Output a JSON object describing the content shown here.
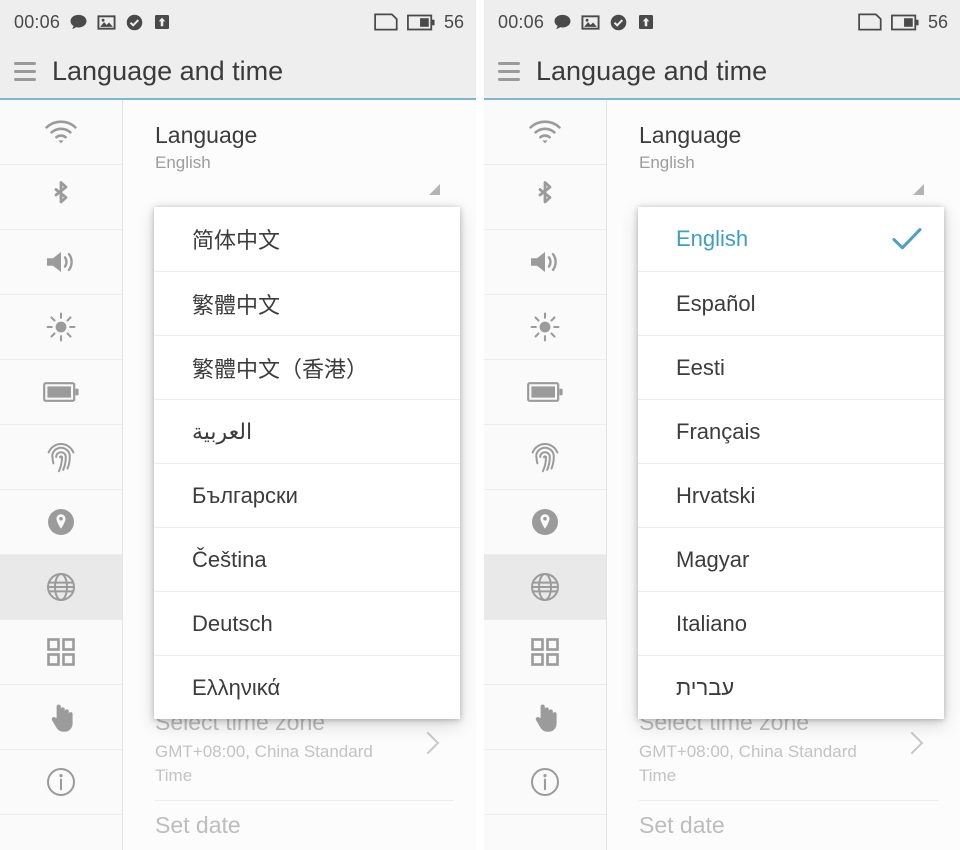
{
  "meta": {
    "accent_color": "#3f9dc4",
    "check_color": "#4aa0c6",
    "header_bg": "#eeeeee",
    "rail_icon_color": "#9b9b9b"
  },
  "status_bar": {
    "time": "00:06",
    "battery_percent": "56",
    "left_icons": [
      "message-icon",
      "photo-icon",
      "check-circle-icon",
      "upload-icon"
    ],
    "right_icons": [
      "sim-card-icon",
      "battery-icon"
    ]
  },
  "header": {
    "menu_icon": "hamburger-icon",
    "title": "Language and time"
  },
  "sidebar": {
    "items": [
      {
        "icon": "wifi-icon",
        "name": "wifi",
        "active": false
      },
      {
        "icon": "bluetooth-icon",
        "name": "bluetooth",
        "active": false
      },
      {
        "icon": "volume-icon",
        "name": "sound",
        "active": false
      },
      {
        "icon": "brightness-icon",
        "name": "display",
        "active": false
      },
      {
        "icon": "battery-icon",
        "name": "battery",
        "active": false
      },
      {
        "icon": "fingerprint-icon",
        "name": "fingerprint",
        "active": false
      },
      {
        "icon": "location-pin-icon",
        "name": "location",
        "active": false
      },
      {
        "icon": "globe-icon",
        "name": "language",
        "active": true
      },
      {
        "icon": "apps-grid-icon",
        "name": "apps",
        "active": false
      },
      {
        "icon": "hand-touch-icon",
        "name": "gestures",
        "active": false
      },
      {
        "icon": "info-circle-icon",
        "name": "about",
        "active": false
      }
    ]
  },
  "content": {
    "language_setting": {
      "label": "Language",
      "value": "English",
      "caret_icon": "dropdown-triangle-icon"
    },
    "timezone_setting": {
      "label": "Select time zone",
      "value": "GMT+08:00, China Standard Time",
      "chevron_icon": "chevron-right-icon"
    },
    "date_setting": {
      "label": "Set date"
    }
  },
  "left_screen": {
    "popup": {
      "items": [
        {
          "label": "简体中文",
          "selected": false,
          "rtl": false
        },
        {
          "label": "繁體中文",
          "selected": false,
          "rtl": false
        },
        {
          "label": "繁體中文（香港）",
          "selected": false,
          "rtl": false
        },
        {
          "label": "العربية",
          "selected": false,
          "rtl": true
        },
        {
          "label": "Български",
          "selected": false,
          "rtl": false
        },
        {
          "label": "Čeština",
          "selected": false,
          "rtl": false
        },
        {
          "label": "Deutsch",
          "selected": false,
          "rtl": false
        },
        {
          "label": "Ελληνικά",
          "selected": false,
          "rtl": false
        }
      ]
    }
  },
  "right_screen": {
    "popup": {
      "items": [
        {
          "label": "English",
          "selected": true,
          "rtl": false
        },
        {
          "label": "Español",
          "selected": false,
          "rtl": false
        },
        {
          "label": "Eesti",
          "selected": false,
          "rtl": false
        },
        {
          "label": "Français",
          "selected": false,
          "rtl": false
        },
        {
          "label": "Hrvatski",
          "selected": false,
          "rtl": false
        },
        {
          "label": "Magyar",
          "selected": false,
          "rtl": false
        },
        {
          "label": "Italiano",
          "selected": false,
          "rtl": false
        },
        {
          "label": "עברית",
          "selected": false,
          "rtl": true
        }
      ]
    }
  }
}
